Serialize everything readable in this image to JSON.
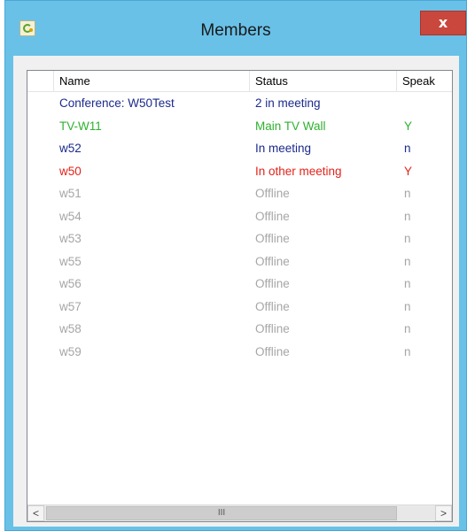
{
  "window": {
    "title": "Members",
    "close_label": "x"
  },
  "columns": [
    "",
    "Name",
    "Status",
    "Speak"
  ],
  "rows": [
    {
      "name": "Conference: W50Test",
      "status": "2 in meeting",
      "speak": "",
      "kind": "conference"
    },
    {
      "name": "TV-W11",
      "status": "Main TV Wall",
      "speak": "Y",
      "kind": "main"
    },
    {
      "name": "w52",
      "status": "In meeting",
      "speak": "n",
      "kind": "meeting"
    },
    {
      "name": "w50",
      "status": "In other meeting",
      "speak": "Y",
      "kind": "other"
    },
    {
      "name": "w51",
      "status": "Offline",
      "speak": "n",
      "kind": "offline"
    },
    {
      "name": "w54",
      "status": "Offline",
      "speak": "n",
      "kind": "offline"
    },
    {
      "name": "w53",
      "status": "Offline",
      "speak": "n",
      "kind": "offline"
    },
    {
      "name": "w55",
      "status": "Offline",
      "speak": "n",
      "kind": "offline"
    },
    {
      "name": "w56",
      "status": "Offline",
      "speak": "n",
      "kind": "offline"
    },
    {
      "name": "w57",
      "status": "Offline",
      "speak": "n",
      "kind": "offline"
    },
    {
      "name": "w58",
      "status": "Offline",
      "speak": "n",
      "kind": "offline"
    },
    {
      "name": "w59",
      "status": "Offline",
      "speak": "n",
      "kind": "offline"
    }
  ],
  "status_colors": {
    "conference": "#1b2a8c",
    "main": "#2fb12f",
    "meeting": "#1b2a8c",
    "other": "#e2231a",
    "offline": "#a6a6a6"
  },
  "scrollbar": {
    "left_arrow": "<",
    "right_arrow": ">",
    "thumb_grip": "III"
  },
  "icons": {
    "app": "app-logo-icon",
    "close": "close-icon"
  }
}
